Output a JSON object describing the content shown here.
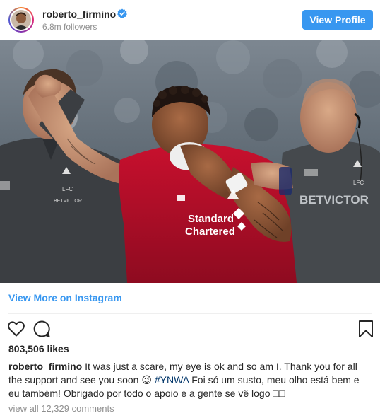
{
  "header": {
    "username": "roberto_firmino",
    "followers": "6.8m followers",
    "view_profile_label": "View Profile",
    "verified_icon": "verified-badge-icon"
  },
  "post": {
    "view_more_label": "View More on Instagram",
    "likes": "803,506 likes",
    "caption_user": "roberto_firmino",
    "caption_part1": " It was just a scare, my eye is ok and so am I. Thank you for all the support and see you soon 😉 ",
    "caption_hashtag": "#YNWA",
    "caption_part2": " Foi só um susto, meu olho está bem e eu também! Obrigado por todo o apoio e a gente se vê logo □□",
    "comments_link": "view all 12,329 comments"
  },
  "photo": {
    "jersey_sponsor_line1": "Standard",
    "jersey_sponsor_line2": "Chartered",
    "staff_sponsor": "BETVICTOR",
    "crest_text": "LFC",
    "staff_sponsor_small": "BETVICTOR"
  },
  "icons": [
    "heart-icon",
    "comment-icon",
    "bookmark-icon",
    "verified-badge-icon"
  ],
  "colors": {
    "accent": "#3897f0",
    "text": "#262626",
    "muted": "#8e8e8e",
    "divider": "#efefef"
  }
}
